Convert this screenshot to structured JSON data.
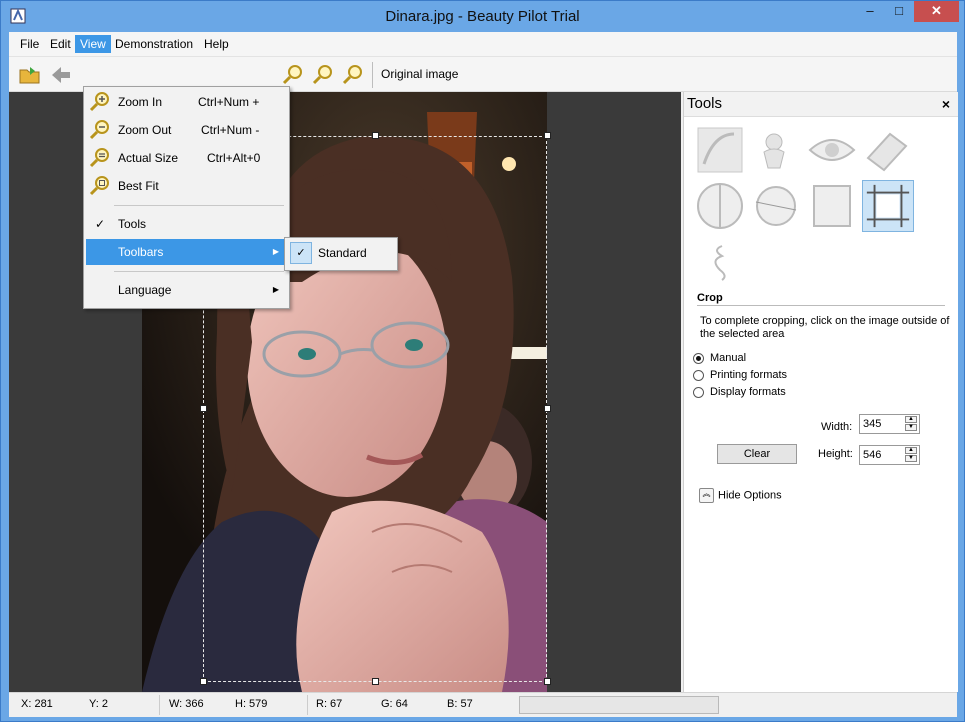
{
  "window": {
    "title": "Dinara.jpg - Beauty Pilot Trial",
    "min": "–",
    "max": "□",
    "close": "✕"
  },
  "menubar": {
    "items": [
      "File",
      "Edit",
      "View",
      "Demonstration",
      "Help"
    ],
    "active": "View"
  },
  "toolbar": {
    "original_image": "Original image"
  },
  "view_menu": {
    "items": [
      {
        "label": "Zoom In",
        "shortcut": "Ctrl+Num +",
        "icon": "zoom-in-icon"
      },
      {
        "label": "Zoom Out",
        "shortcut": "Ctrl+Num -",
        "icon": "zoom-out-icon"
      },
      {
        "label": "Actual Size",
        "shortcut": "Ctrl+Alt+0",
        "icon": "actual-size-icon"
      },
      {
        "label": "Best Fit",
        "shortcut": "",
        "icon": "best-fit-icon"
      }
    ],
    "tools": {
      "label": "Tools",
      "check": "✓"
    },
    "toolbars": {
      "label": "Toolbars",
      "arrow": "▶"
    },
    "language": {
      "label": "Language",
      "arrow": "▶"
    }
  },
  "toolbars_submenu": {
    "label": "Standard",
    "check": "✓"
  },
  "tools_panel": {
    "title": "Tools",
    "close": "×",
    "section": "Crop",
    "description": "To complete cropping, click on the image outside of the selected area",
    "options": [
      {
        "label": "Manual",
        "selected": true
      },
      {
        "label": "Printing formats",
        "selected": false
      },
      {
        "label": "Display formats",
        "selected": false
      }
    ],
    "width_label": "Width:",
    "width_value": "345",
    "height_label": "Height:",
    "height_value": "546",
    "clear": "Clear",
    "hide_options": "Hide Options",
    "up_arrow": "▲",
    "down_arrow": "▼",
    "hide_arrow": "︽"
  },
  "status": {
    "x": "X: 281",
    "y": "Y: 2",
    "w": "W: 366",
    "h": "H: 579",
    "r": "R: 67",
    "g": "G: 64",
    "b": "B: 57",
    "progress": 0
  },
  "colors": {
    "titlebar": "#6aa7e6",
    "highlight": "#3c97e6",
    "close": "#c74f4f"
  }
}
